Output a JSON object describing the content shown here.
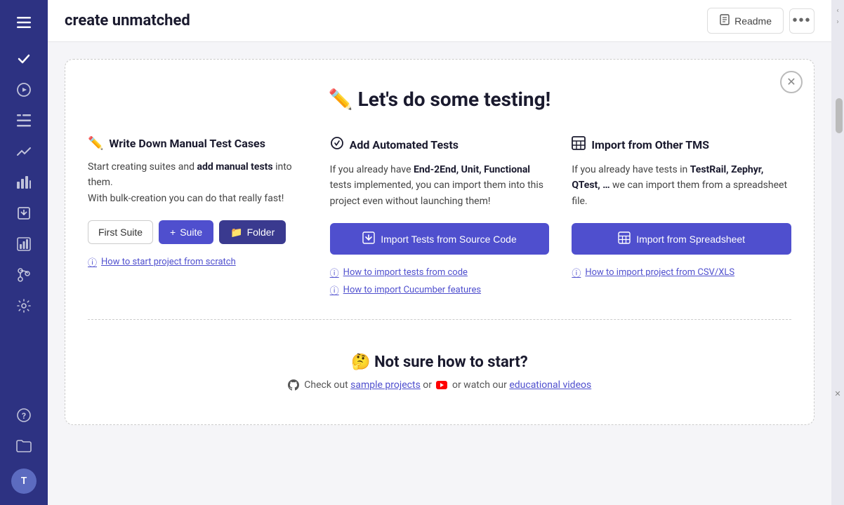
{
  "app": {
    "title": "create unmatched"
  },
  "header": {
    "readme_label": "Readme",
    "more_label": "···"
  },
  "sidebar": {
    "icons": [
      {
        "name": "hamburger-icon",
        "symbol": "☰",
        "active": true
      },
      {
        "name": "check-icon",
        "symbol": "✓"
      },
      {
        "name": "circle-play-icon",
        "symbol": "▶"
      },
      {
        "name": "list-check-icon",
        "symbol": "☰"
      },
      {
        "name": "trending-icon",
        "symbol": "📈"
      },
      {
        "name": "analytics-icon",
        "symbol": "📊"
      },
      {
        "name": "import-icon",
        "symbol": "📥"
      },
      {
        "name": "chart-bar-icon",
        "symbol": "📊"
      },
      {
        "name": "git-icon",
        "symbol": "⑂"
      },
      {
        "name": "settings-icon",
        "symbol": "⚙"
      }
    ],
    "bottom_icons": [
      {
        "name": "help-icon",
        "symbol": "?"
      },
      {
        "name": "folder-icon",
        "symbol": "📁"
      }
    ],
    "avatar_initials": "T"
  },
  "welcome": {
    "close_label": "✕",
    "title_emoji": "✏️",
    "title": "Let's do some testing!",
    "columns": [
      {
        "id": "manual",
        "icon": "✏️",
        "heading": "Write Down Manual Test Cases",
        "text_before": "Start creating suites and ",
        "text_bold": "add manual tests",
        "text_after": " into them.\nWith bulk-creation you can do that really fast!",
        "buttons": [
          {
            "label": "First Suite",
            "type": "outline",
            "icon": ""
          },
          {
            "label": "+ Suite",
            "type": "primary",
            "icon": "+"
          },
          {
            "label": "📁 Folder",
            "type": "primary-light",
            "icon": "📁"
          }
        ],
        "links": [
          {
            "label": "How to start project from scratch"
          }
        ]
      },
      {
        "id": "automated",
        "icon": "🔄",
        "heading": "Add Automated Tests",
        "text_before": "If you already have ",
        "text_bold": "End-2End, Unit, Functional",
        "text_after": " tests implemented, you can import them into this project even without launching them!",
        "button_label": "Import Tests from Source Code",
        "button_icon": "💾",
        "links": [
          {
            "label": "How to import tests from code"
          },
          {
            "label": "How to import Cucumber features"
          }
        ]
      },
      {
        "id": "tms",
        "icon": "📋",
        "heading": "Import from Other TMS",
        "text_before": "If you already have tests in ",
        "text_bold": "TestRail, Zephyr, QTest, …",
        "text_after": " we can import them from a spreadsheet file.",
        "button_label": "Import from Spreadsheet",
        "button_icon": "📋",
        "links": [
          {
            "label": "How to import project from CSV/XLS"
          }
        ]
      }
    ]
  },
  "bottom": {
    "emoji": "🤔",
    "title": "Not sure how to start?",
    "text_before": "Check out ",
    "link1_label": "sample projects",
    "text_middle": " or ",
    "icon_youtube": "▶",
    "text_watch": "or watch our ",
    "link2_label": "educational videos"
  }
}
